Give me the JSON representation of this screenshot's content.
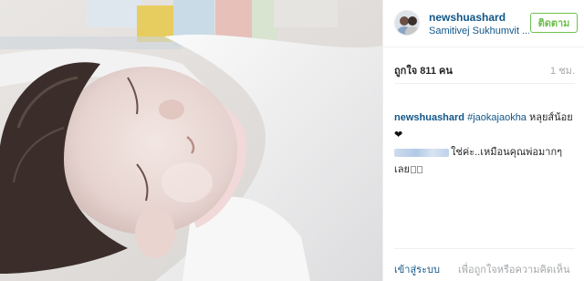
{
  "post": {
    "username": "newshuashard",
    "location": "Samitivej Sukhumvit ...",
    "follow_label": "ติดตาม",
    "likes": "ถูกใจ 811 คน",
    "timestamp": "1 ชม.",
    "caption": {
      "username": "newshuashard",
      "hashtag": "#jaokajaokha",
      "line1_rest": "หลุยส์น้อย",
      "heart": "❤",
      "line2": "ใช่ค่ะ..เหมือนคุณพ่อมากๆ",
      "line3": "เลย"
    },
    "footer": {
      "login_link": "เข้าสู่ระบบ",
      "prompt": "เพื่อถูกใจหรือความคิดเห็น"
    }
  },
  "colors": {
    "link_blue": "#125688",
    "follow_green": "#70c050",
    "muted_gray": "#a5a7aa"
  },
  "photo": {
    "subject": "sleeping newborn baby swaddled in white blanket"
  }
}
